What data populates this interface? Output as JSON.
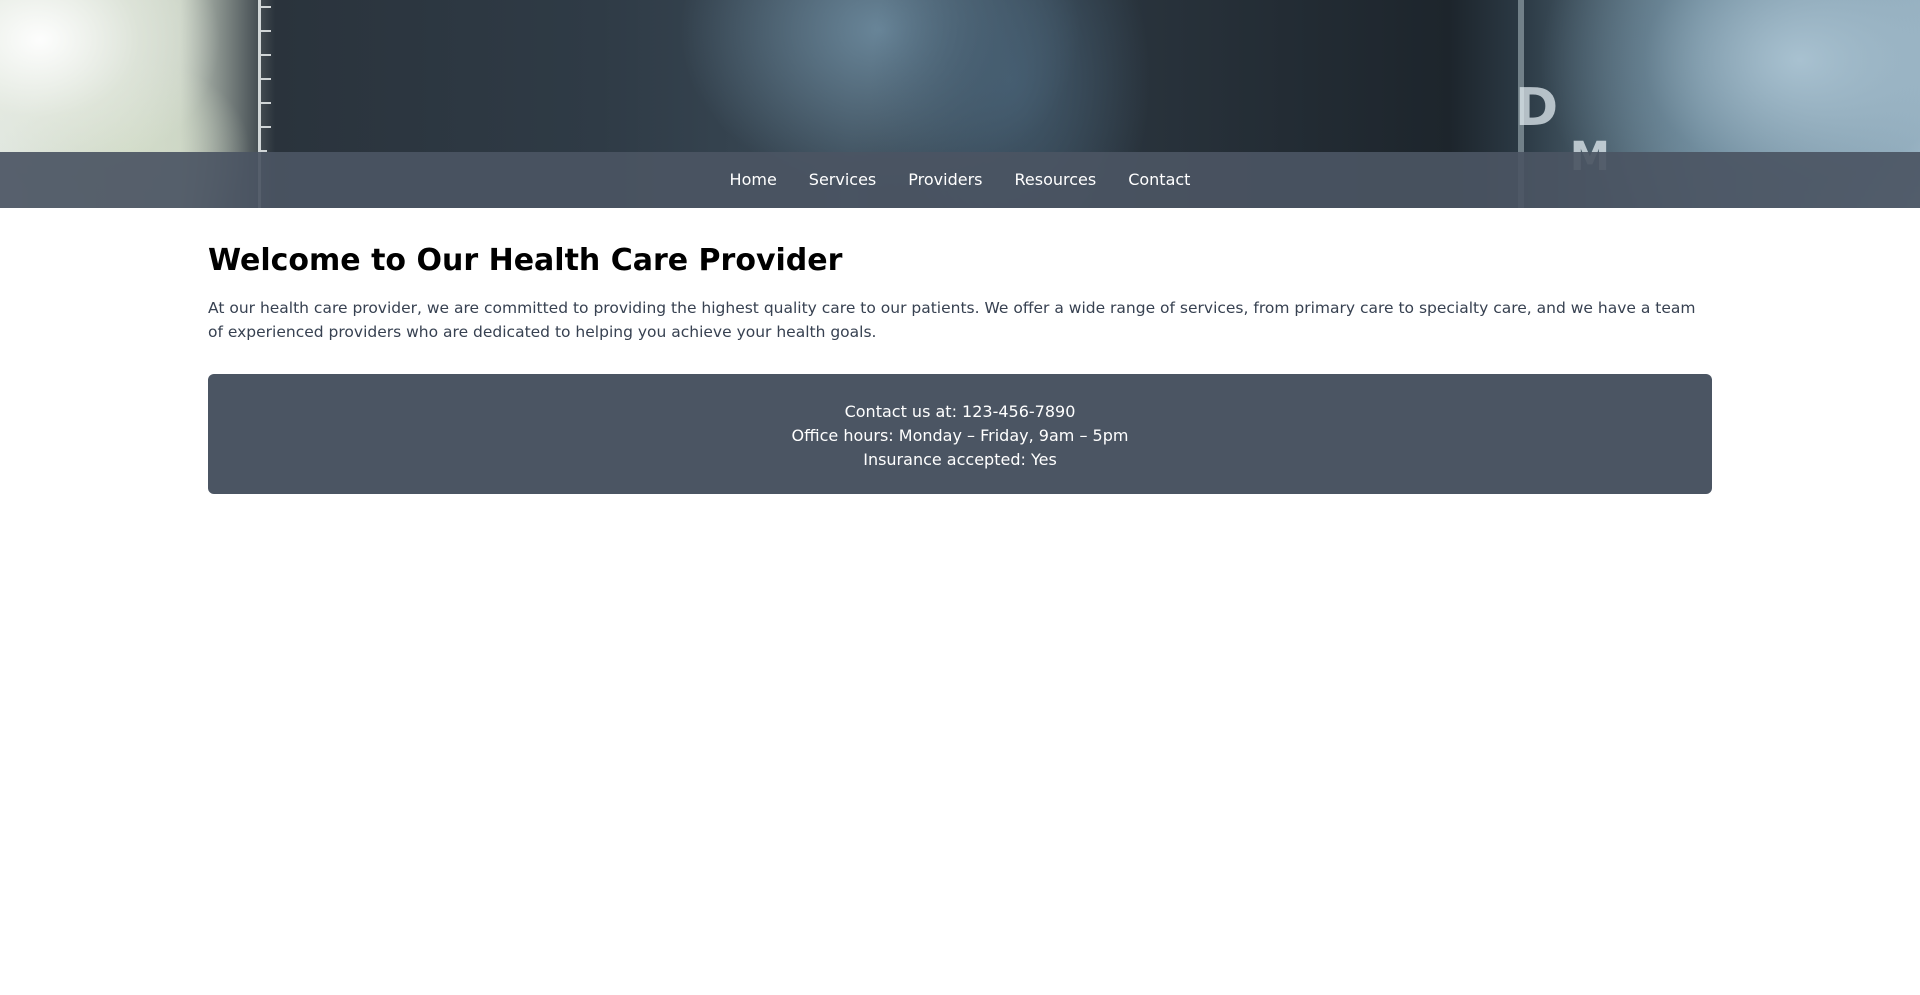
{
  "nav": {
    "items": [
      {
        "label": "Home"
      },
      {
        "label": "Services"
      },
      {
        "label": "Providers"
      },
      {
        "label": "Resources"
      },
      {
        "label": "Contact"
      }
    ]
  },
  "hero": {
    "image_glyphs": [
      "D",
      "M"
    ]
  },
  "main": {
    "title": "Welcome to Our Health Care Provider",
    "intro": "At our health care provider, we are committed to providing the highest quality care to our patients. We offer a wide range of services, from primary care to specialty care, and we have a team of experienced providers who are dedicated to helping you achieve your health goals.",
    "info": {
      "contact": "Contact us at: 123-456-7890",
      "hours": "Office hours: Monday – Friday, 9am – 5pm",
      "insurance": "Insurance accepted: Yes"
    }
  },
  "colors": {
    "navbar_bg": "#4b5563",
    "info_bg": "#4b5563",
    "title": "#000000",
    "body_text": "#374151"
  }
}
